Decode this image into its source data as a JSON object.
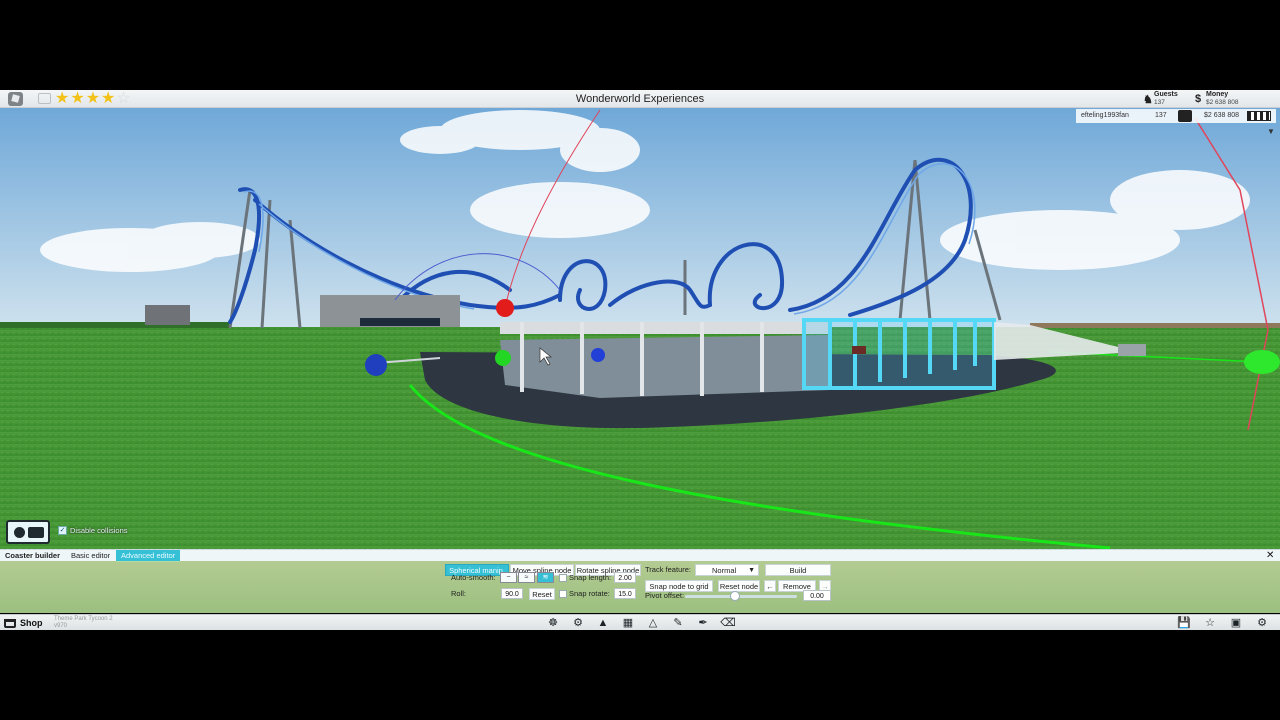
{
  "window": {
    "title": "Wonderworld Experiences"
  },
  "rating": {
    "stars": 3.5,
    "max": 5
  },
  "stats": {
    "guests": {
      "label": "Guests",
      "value": "137"
    },
    "money": {
      "label": "Money",
      "value": "$2 638 808"
    }
  },
  "player_list": {
    "name": "efteling1993fan",
    "guests": "137",
    "money": "$2 638 808"
  },
  "collision": {
    "label": "Disable collisions",
    "checked": true
  },
  "editor": {
    "tabs": [
      {
        "label": "Coaster builder"
      },
      {
        "label": "Basic editor"
      },
      {
        "label": "Advanced editor",
        "active": true
      }
    ],
    "modes": [
      {
        "label": "Spherical manip.",
        "active": true
      },
      {
        "label": "Move spline node"
      },
      {
        "label": "Rotate spline node"
      }
    ],
    "auto_smooth_label": "Auto-smooth:",
    "roll_label": "Roll:",
    "roll_value": "90.0",
    "reset_label": "Reset",
    "snap_length_label": "Snap length:",
    "snap_length_value": "2.00",
    "snap_rotate_label": "Snap rotate:",
    "snap_rotate_value": "15.0",
    "track_feature_label": "Track feature:",
    "track_feature_value": "Normal",
    "build_label": "Build",
    "snap_grid_label": "Snap node to grid",
    "reset_node_label": "Reset node",
    "remove_label": "Remove",
    "pivot_offset_label": "Pivot offset:",
    "pivot_offset_value": "0.00",
    "pivot_offset_fraction": 0.45
  },
  "bottom": {
    "shop_label": "Shop",
    "game_name": "Theme Park Tycoon 2",
    "game_version": "v970",
    "tools": [
      "rides-icon",
      "food-icon",
      "tree-icon",
      "path-icon",
      "terrain-icon",
      "paint-icon",
      "brush-icon",
      "trash-icon"
    ],
    "system": [
      "save-icon",
      "trophy-icon",
      "calendar-icon",
      "settings-icon"
    ]
  },
  "colors": {
    "accent": "#36c0d6",
    "grass": "#3e9a34",
    "sky": "#8fc1e3",
    "track": "#1f4fb3"
  }
}
